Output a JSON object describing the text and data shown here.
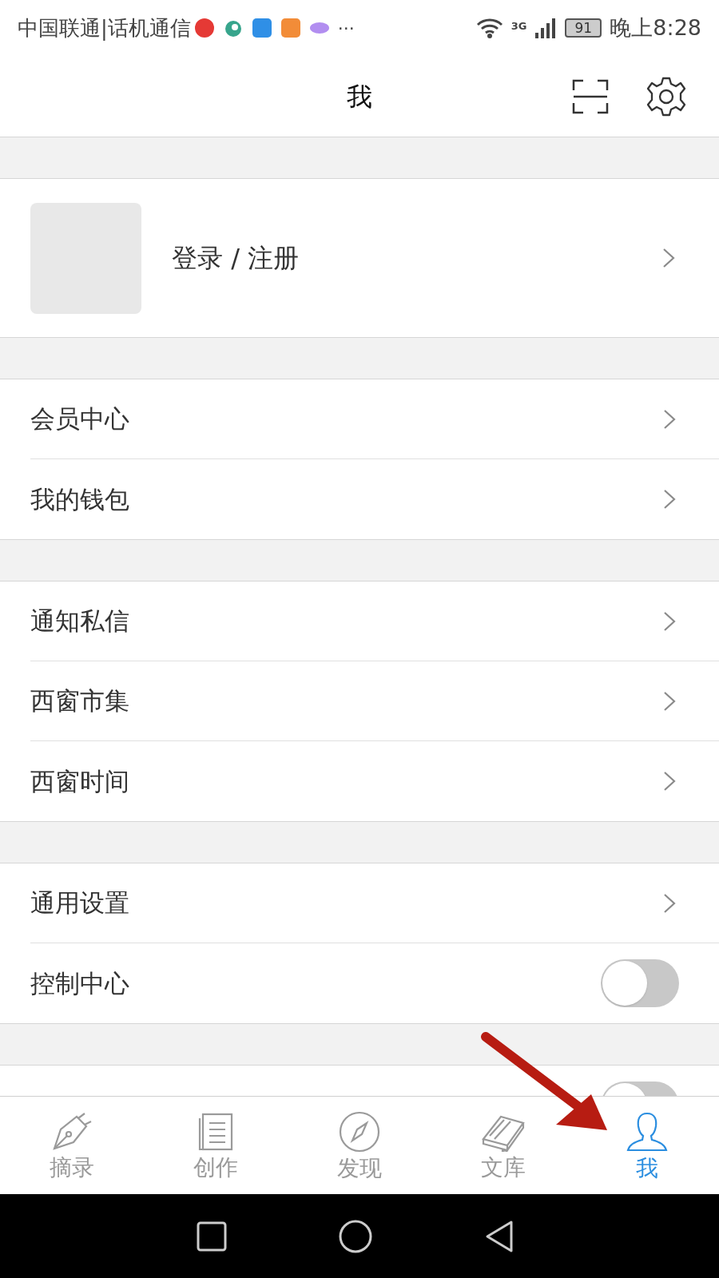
{
  "status_bar": {
    "carrier": "中国联通|话机通信",
    "more": "···",
    "battery": "91",
    "time": "晚上8:28",
    "network": "3G"
  },
  "header": {
    "title": "我"
  },
  "profile": {
    "label": "登录 / 注册"
  },
  "groups": [
    [
      {
        "label": "会员中心",
        "kind": "link"
      },
      {
        "label": "我的钱包",
        "kind": "link"
      }
    ],
    [
      {
        "label": "通知私信",
        "kind": "link"
      },
      {
        "label": "西窗市集",
        "kind": "link"
      },
      {
        "label": "西窗时间",
        "kind": "link"
      }
    ],
    [
      {
        "label": "通用设置",
        "kind": "link"
      },
      {
        "label": "控制中心",
        "kind": "toggle",
        "on": false
      }
    ],
    [
      {
        "kind": "toggle",
        "on": false
      }
    ]
  ],
  "tabs": [
    {
      "label": "摘录",
      "kind": "pen",
      "selected": false
    },
    {
      "label": "创作",
      "kind": "doc",
      "selected": false
    },
    {
      "label": "发现",
      "kind": "compass",
      "selected": false
    },
    {
      "label": "文库",
      "kind": "book",
      "selected": false
    },
    {
      "label": "我",
      "kind": "user",
      "selected": true
    }
  ]
}
